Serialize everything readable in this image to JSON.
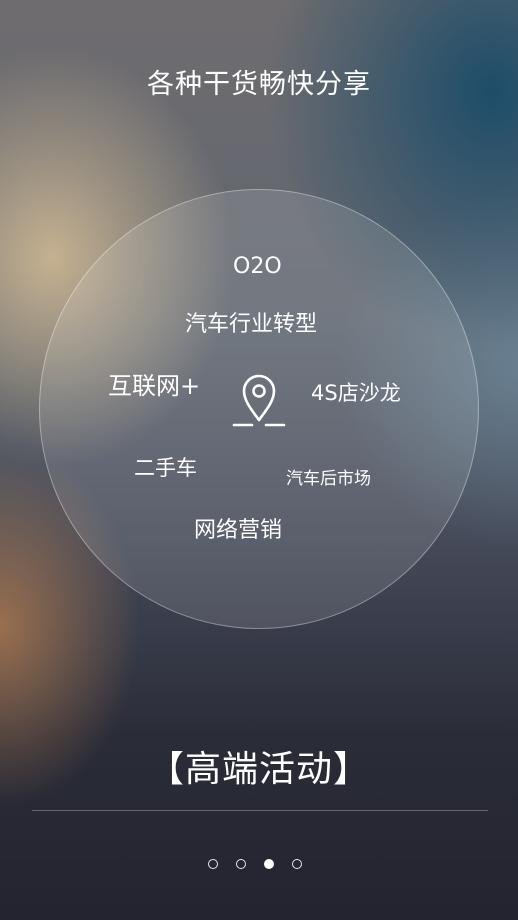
{
  "page": {
    "title": "各种干货畅快分享",
    "banner": "【高端活动】"
  },
  "topic_circle": {
    "center_icon": "location-pin-icon",
    "tags": {
      "o2o": "O2O",
      "industry_transformation": "汽车行业转型",
      "internet_plus": "互联网+",
      "salon_4s": "4S店沙龙",
      "used_car": "二手车",
      "aftermarket": "汽车后市场",
      "online_marketing": "网络营销"
    }
  },
  "pager": {
    "count": 4,
    "active_index": 2
  },
  "colors": {
    "text": "#ffffff",
    "circle_border": "rgba(255,255,255,0.35)"
  }
}
